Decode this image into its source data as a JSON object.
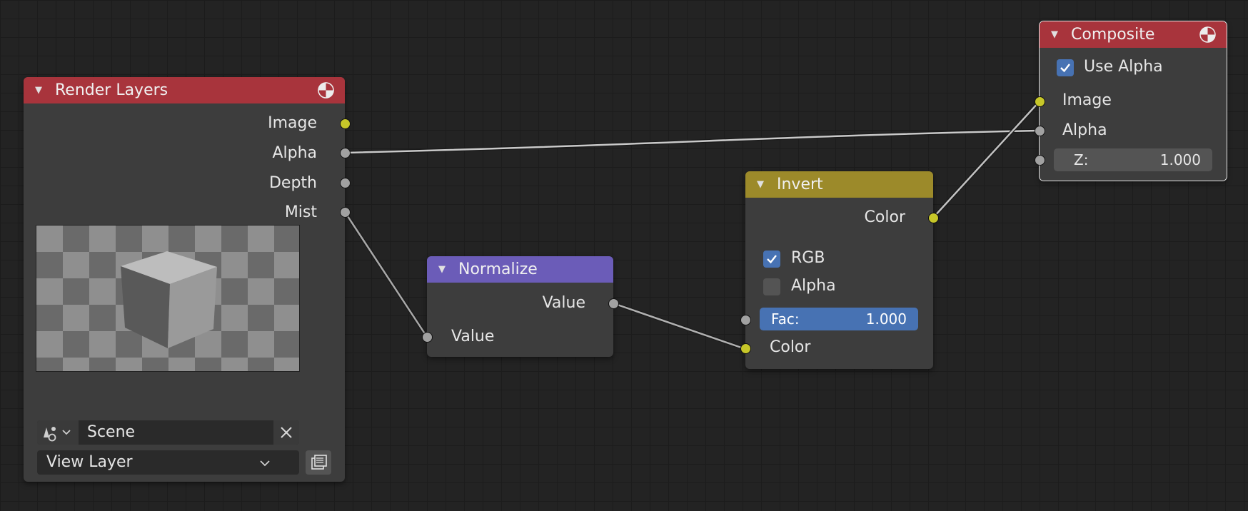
{
  "colors": {
    "output_header": "#a8343c",
    "converter_header": "#6b5cb8",
    "color_header": "#9c8a2a",
    "socket_color": "#c7c729",
    "socket_value": "#a1a1a1",
    "accent": "#4772b3"
  },
  "render_layers": {
    "title": "Render Layers",
    "header_icon": "render-result-icon",
    "outputs": [
      "Image",
      "Alpha",
      "Depth",
      "Mist"
    ],
    "scene_icon": "scene-data-icon",
    "scene": "Scene",
    "clear_icon": "close-icon",
    "view_layer": "View Layer",
    "view_layer_icon": "view-layer-browse-icon"
  },
  "normalize": {
    "title": "Normalize",
    "output": "Value",
    "input": "Value"
  },
  "invert": {
    "title": "Invert",
    "output": "Color",
    "rgb_label": "RGB",
    "rgb_checked": true,
    "alpha_label": "Alpha",
    "alpha_checked": false,
    "fac_label": "Fac:",
    "fac_value": "1.000",
    "color_input": "Color"
  },
  "composite": {
    "title": "Composite",
    "header_icon": "render-result-icon",
    "use_alpha_label": "Use Alpha",
    "use_alpha_checked": true,
    "inputs": [
      "Image",
      "Alpha"
    ],
    "z_label": "Z:",
    "z_value": "1.000"
  }
}
